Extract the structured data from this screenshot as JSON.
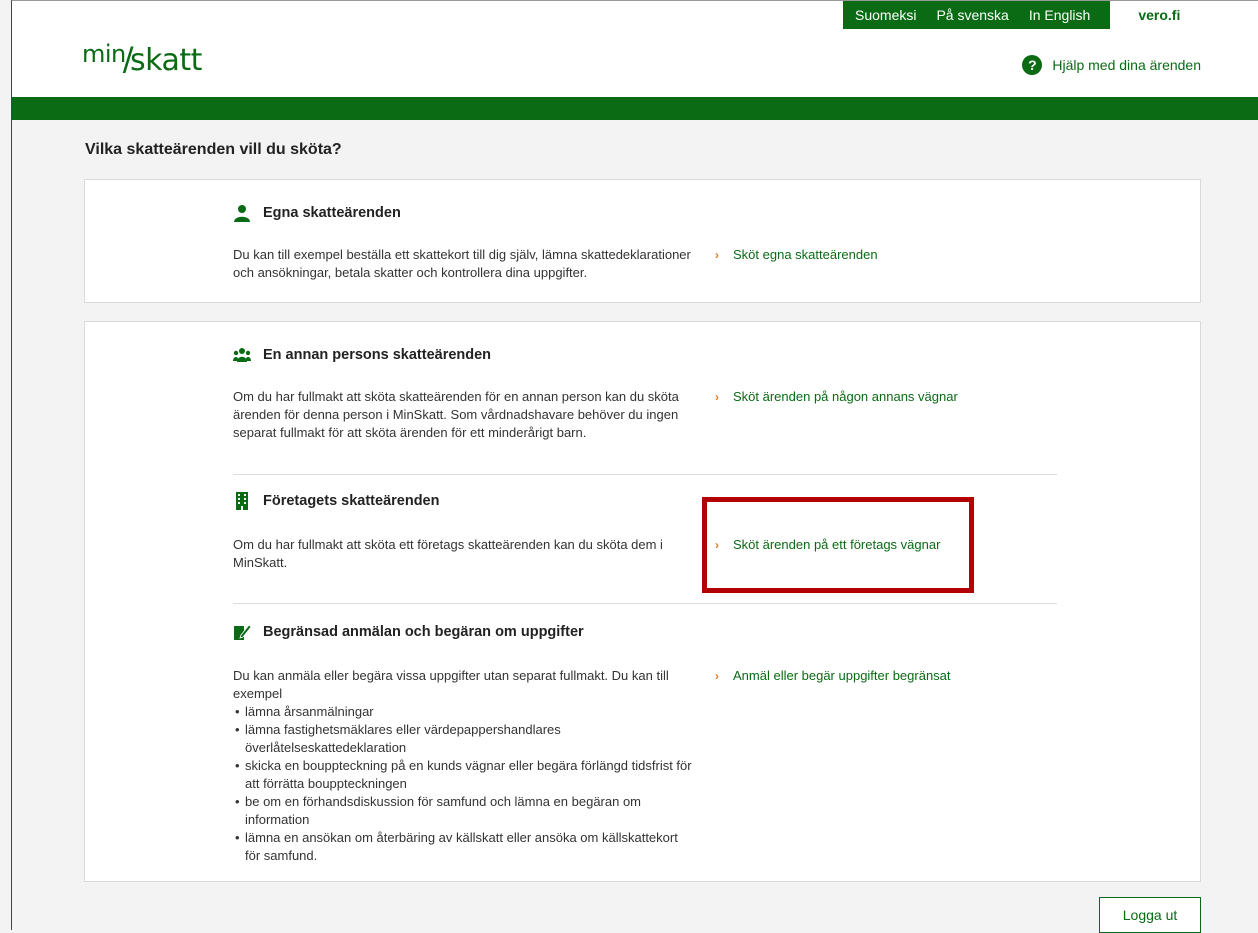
{
  "header": {
    "languages": [
      "Suomeksi",
      "På svenska",
      "In English"
    ],
    "vero_link": "vero.fi",
    "logo_min": "min",
    "logo_slash": "/",
    "logo_skatt": "skatt",
    "help_icon_glyph": "?",
    "help_label": "Hjälp med dina ärenden"
  },
  "page_title": "Vilka skatteärenden vill du sköta?",
  "sections": [
    {
      "title": "Egna skatteärenden",
      "icon": "person-icon",
      "text": "Du kan till exempel beställa ett skattekort till dig själv, lämna skattedeklarationer och ansökningar, betala skatter och kontrollera dina uppgifter.",
      "link": "Sköt egna skatteärenden"
    },
    {
      "title": "En annan persons skatteärenden",
      "icon": "group-icon",
      "text": "Om du har fullmakt att sköta skatteärenden för en annan person kan du sköta ärenden för denna person i MinSkatt. Som vårdnadshavare behöver du ingen separat fullmakt för att sköta ärenden för ett minderårigt barn.",
      "link": "Sköt ärenden på någon annans vägnar"
    },
    {
      "title": "Företagets skatteärenden",
      "icon": "building-icon",
      "text": "Om du har fullmakt att sköta ett företags skatteärenden kan du sköta dem i MinSkatt.",
      "link": "Sköt ärenden på ett företags vägnar"
    },
    {
      "title": "Begränsad anmälan och begäran om uppgifter",
      "icon": "document-edit-icon",
      "text": "Du kan anmäla eller begära vissa uppgifter utan separat fullmakt. Du kan till exempel",
      "bullets": [
        "lämna årsanmälningar",
        "lämna fastighetsmäklares eller värdepappershandlares överlåtelseskattedeklaration",
        "skicka en bouppteckning på en kunds vägnar eller begära förlängd tidsfrist för att förrätta bouppteckningen",
        "be om en förhandsdiskussion för samfund och lämna en begäran om information",
        "lämna en ansökan om återbäring av källskatt eller ansöka om källskattekort för samfund."
      ],
      "link": "Anmäl eller begär uppgifter begränsat"
    }
  ],
  "chevron_glyph": "›",
  "logout_label": "Logga ut",
  "colors": {
    "brand_green": "#0a6b14",
    "accent_orange": "#e57a1e",
    "highlight_red": "#b30000"
  }
}
